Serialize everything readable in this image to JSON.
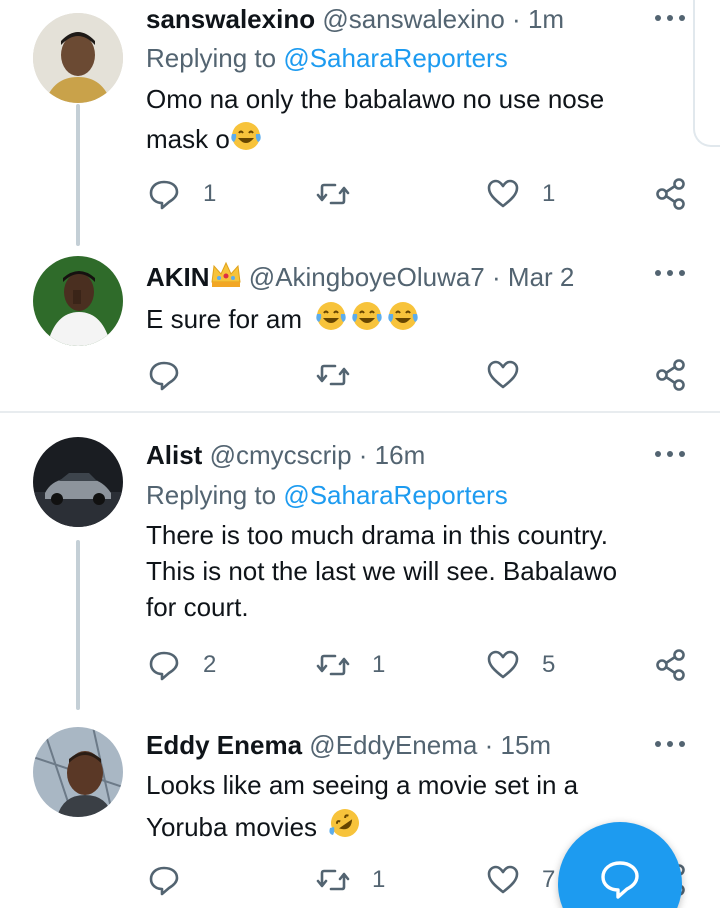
{
  "tweets": [
    {
      "name": "sanswalexino",
      "handle": "@sanswalexino",
      "time": "1m",
      "replying_prefix": "Replying to",
      "replying_to": "@SaharaReporters",
      "text_lines": [
        "Omo na only the babalawo no use nose",
        "mask o"
      ],
      "emoji_after": [
        "face-with-tears-of-joy"
      ],
      "stats": {
        "replies": "1",
        "retweets": "",
        "likes": "1"
      }
    },
    {
      "name": "AKIN",
      "name_emoji": "crown-icon",
      "handle": "@AkingboyeOluwa7",
      "time": "Mar 2",
      "text_lines": [
        "E sure for am"
      ],
      "emoji_after": [
        "face-with-tears-of-joy",
        "face-with-tears-of-joy",
        "face-with-tears-of-joy"
      ],
      "stats": {
        "replies": "",
        "retweets": "",
        "likes": ""
      }
    },
    {
      "name": "Alist",
      "handle": "@cmycscrip",
      "time": "16m",
      "replying_prefix": "Replying to",
      "replying_to": "@SaharaReporters",
      "text_lines": [
        "There is too much drama in this country.",
        "This is not the last we will see. Babalawo",
        "for court."
      ],
      "stats": {
        "replies": "2",
        "retweets": "1",
        "likes": "5"
      }
    },
    {
      "name": "Eddy Enema",
      "handle": "@EddyEnema",
      "time": "15m",
      "text_lines": [
        "Looks like am seeing a movie set in a",
        "Yoruba movies"
      ],
      "emoji_after": [
        "rolling-on-floor-laughing"
      ],
      "stats": {
        "replies": "",
        "retweets": "1",
        "likes": "7"
      }
    }
  ],
  "separator": "·",
  "colors": {
    "accent": "#1d9bf0",
    "secondary_text": "#536471",
    "primary_text": "#0f1419"
  },
  "fab_icon": "compose-reply-icon"
}
